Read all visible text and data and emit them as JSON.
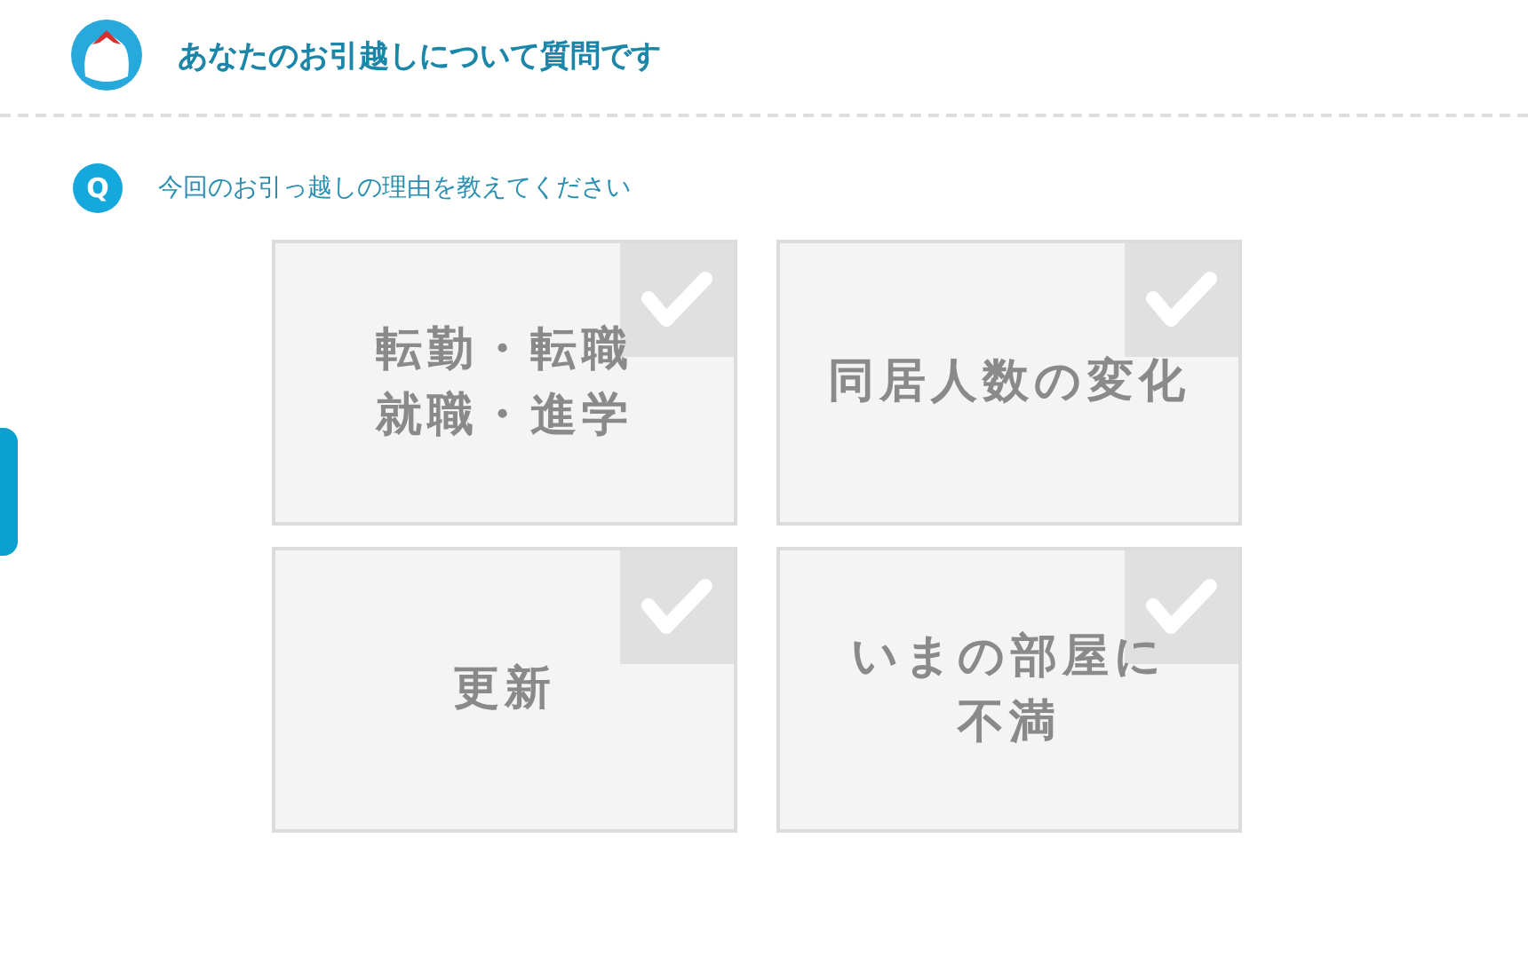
{
  "header": {
    "title": "あなたのお引越しについて質問です"
  },
  "question": {
    "badge": "Q",
    "text": "今回のお引っ越しの理由を教えてください"
  },
  "options": [
    {
      "lines": [
        "転勤・転職",
        "就職・進学"
      ],
      "checked": false
    },
    {
      "lines": [
        "同居人数の変化"
      ],
      "checked": false
    },
    {
      "lines": [
        "更新"
      ],
      "checked": false
    },
    {
      "lines": [
        "いまの部屋に",
        "不満"
      ],
      "checked": false
    }
  ]
}
